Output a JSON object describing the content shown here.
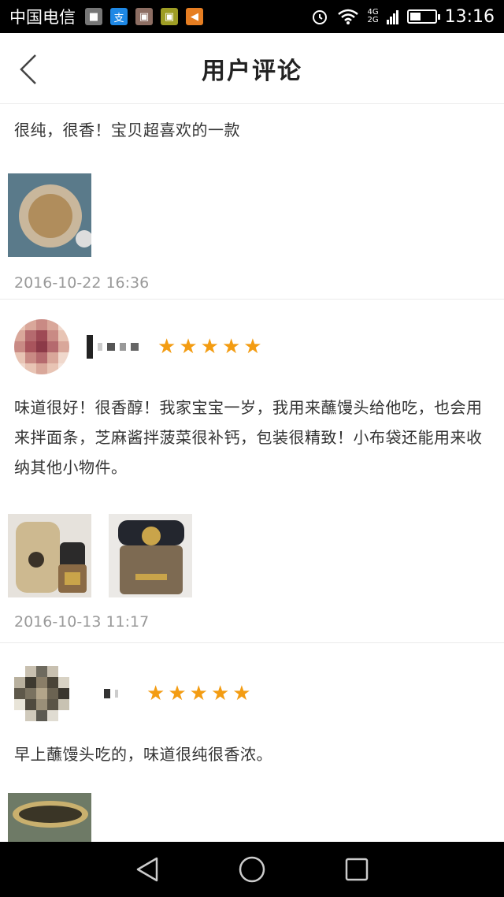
{
  "status_bar": {
    "carrier": "中国电信",
    "network_top": "4G",
    "network_bottom": "2G",
    "time": "13:16",
    "battery_level": 0.45
  },
  "header": {
    "title": "用户评论"
  },
  "reviews": [
    {
      "text": "很纯，很香！宝贝超喜欢的一款",
      "date": "2016-10-22 16:36",
      "photo_count": 1
    },
    {
      "rating": 5,
      "text": "味道很好！很香醇！我家宝宝一岁，我用来蘸馒头给他吃，也会用来拌面条，芝麻酱拌菠菜很补钙，包装很精致！小布袋还能用来收纳其他小物件。",
      "date": "2016-10-13 11:17",
      "photo_count": 2
    },
    {
      "rating": 5,
      "text": "早上蘸馒头吃的，味道很纯很香浓。",
      "photo_count": 1
    }
  ],
  "colors": {
    "star": "#f39c12",
    "date": "#999999",
    "status_bar_bg": "#000000",
    "nav_bar_bg": "#000000"
  },
  "icons": {
    "back": "chevron-left-icon",
    "star": "star-icon",
    "nav_back": "triangle-back-icon",
    "nav_home": "circle-home-icon",
    "nav_recent": "square-recent-icon"
  }
}
